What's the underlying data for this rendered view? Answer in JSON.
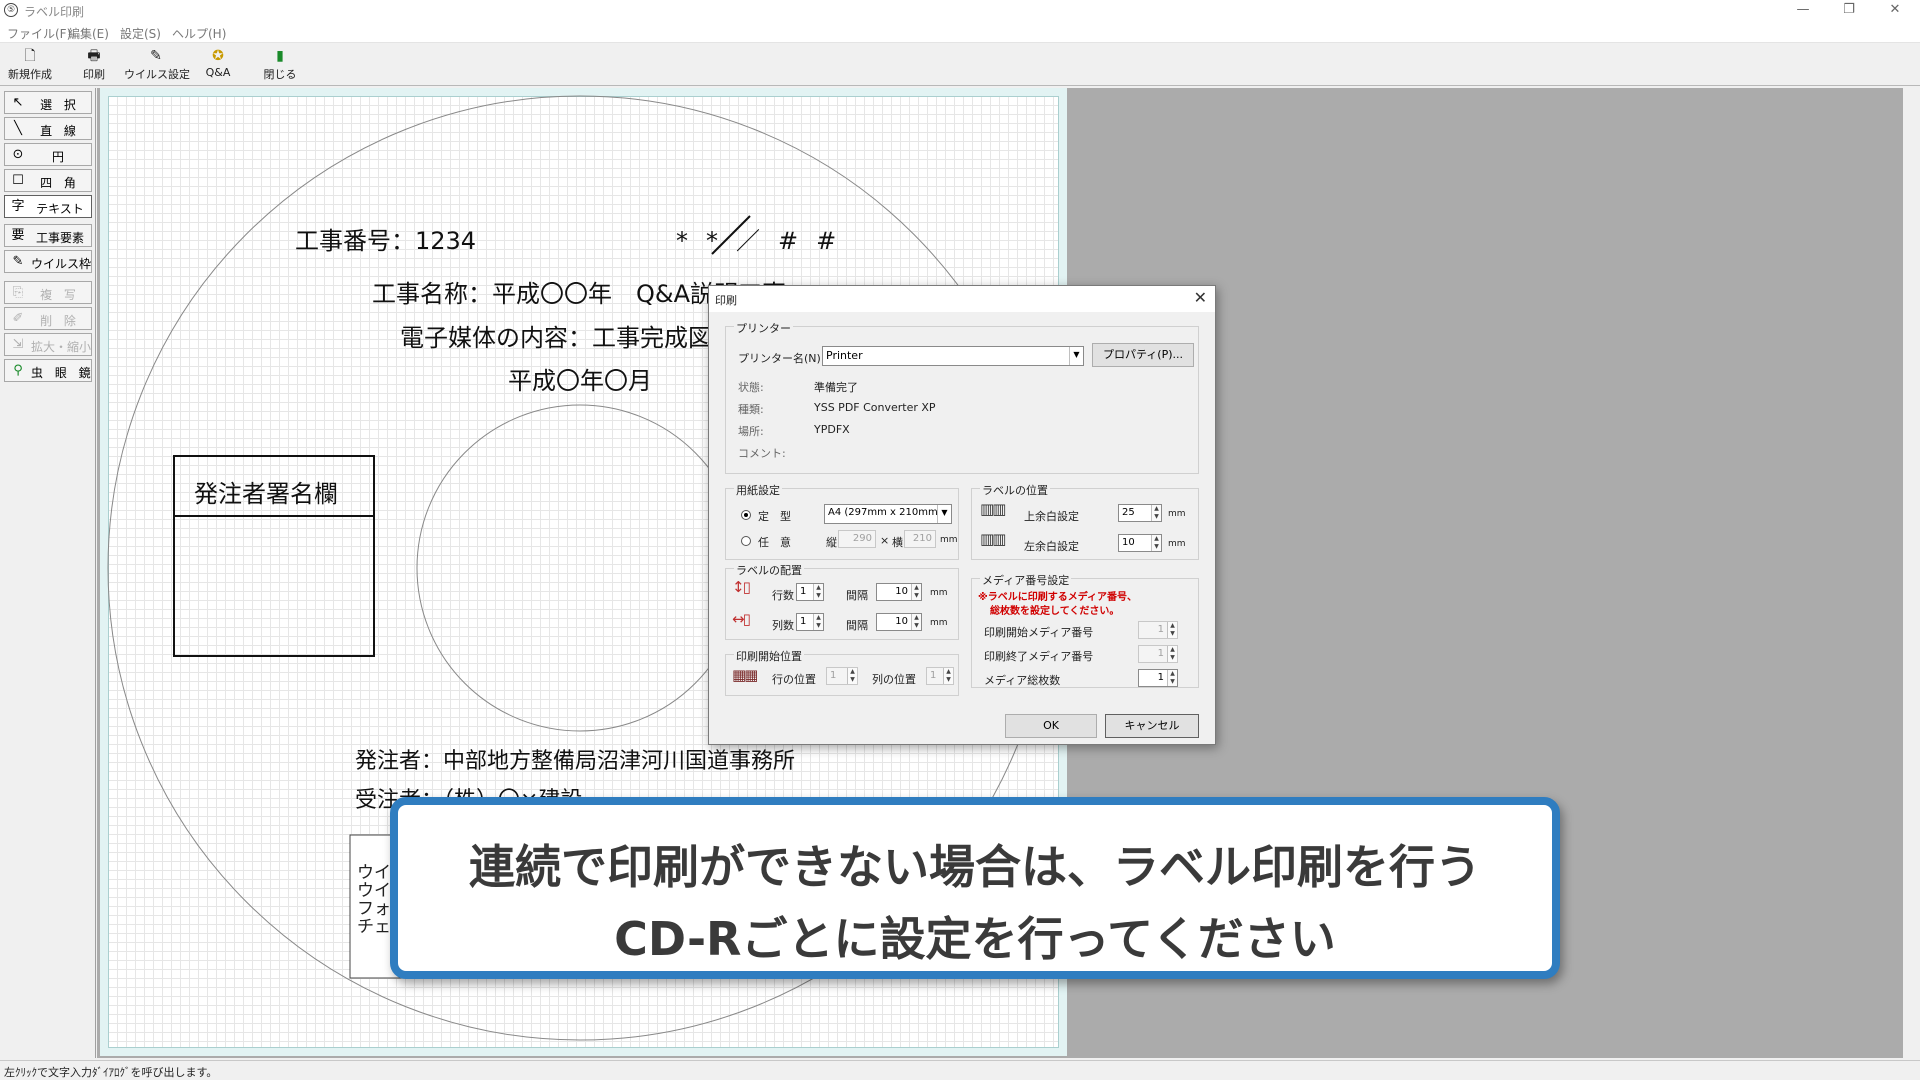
{
  "window": {
    "title": "ラベル印刷",
    "app_icon": "⑤",
    "minimize_icon": "—",
    "restore_icon": "❐",
    "close_icon": "✕"
  },
  "menu": [
    "ファイル(F)",
    "編集(E)",
    "設定(S)",
    "ヘルプ(H)"
  ],
  "toolbar": [
    {
      "label": "新規作成",
      "icon": "new-file-icon",
      "glyph": "🗋"
    },
    {
      "label": "印刷",
      "icon": "printer-icon",
      "glyph": "🖶"
    },
    {
      "label": "ウイルス設定",
      "icon": "virus-settings-icon",
      "glyph": "✎"
    },
    {
      "label": "Q&A",
      "icon": "qa-icon",
      "glyph": "✪"
    },
    {
      "label": "閉じる",
      "icon": "exit-door-icon",
      "glyph": "▮"
    }
  ],
  "tools": [
    {
      "label": "選 択",
      "glyph": "↖",
      "icon": "cursor-icon"
    },
    {
      "label": "直 線",
      "glyph": "╲",
      "icon": "line-icon"
    },
    {
      "label": "円",
      "glyph": "⊙",
      "icon": "circle-icon"
    },
    {
      "label": "四 角",
      "glyph": "☐",
      "icon": "rectangle-icon"
    },
    {
      "label": "テキスト",
      "glyph": "字",
      "icon": "text-icon"
    },
    {
      "label": "工事要素",
      "glyph": "要",
      "icon": "construction-element-icon"
    },
    {
      "label": "ウイルス枠",
      "glyph": "✎",
      "icon": "virus-frame-icon"
    },
    {
      "label": "複 写",
      "glyph": "⎘",
      "icon": "copy-icon"
    },
    {
      "label": "削 除",
      "glyph": "✐",
      "icon": "delete-icon"
    },
    {
      "label": "拡大・縮小",
      "glyph": "⇲",
      "icon": "resize-icon"
    },
    {
      "label": "虫 眼 鏡",
      "glyph": "⚲",
      "icon": "magnifier-icon"
    }
  ],
  "label": {
    "line1": "工事番号：1234",
    "date_mark": "**／##",
    "line2": "工事名称：平成〇〇年　Q&A説明工事",
    "line3": "電子媒体の内容：工事完成図",
    "line4": "平成〇年〇月",
    "signature_box": "発注者署名欄",
    "client": "発注者：中部地方整備局沼津河川国道事務所",
    "contractor": "受注者：（株）〇×建設",
    "virus_box_lines": [
      "ウイ",
      "ウイ",
      "フォ",
      "チェ"
    ]
  },
  "status_bar": "左ｸﾘｯｸで文字入力ﾀﾞｲｱﾛｸﾞを呼び出します。",
  "dialog": {
    "title": "印刷",
    "close": "✕",
    "printer_group": "プリンター",
    "printer_name_label": "プリンター名(N):",
    "printer_name_value": "Printer",
    "properties_button": "プロパティ(P)...",
    "status_label": "状態:",
    "status_value": "準備完了",
    "type_label": "種類:",
    "type_value": "YSS PDF Converter XP",
    "location_label": "場所:",
    "location_value": "YPDFX",
    "comment_label": "コメント:",
    "paper_group": "用紙設定",
    "fixed_label": "定　型",
    "fixed_value": "A4 (297mm x 210mm)",
    "custom_label": "任　意",
    "height_label": "縦",
    "height_value": "290",
    "times": "×",
    "width_label": "横",
    "width_value": "210",
    "mm": "mm",
    "label_pos_group": "ラベルの位置",
    "top_margin_label": "上余白設定",
    "top_margin_value": "25",
    "left_margin_label": "左余白設定",
    "left_margin_value": "10",
    "layout_group": "ラベルの配置",
    "rows_label": "行数",
    "rows_value": "1",
    "cols_label": "列数",
    "cols_value": "1",
    "gap_label": "間隔",
    "row_gap_value": "10",
    "col_gap_value": "10",
    "media_group": "メディア番号設定",
    "media_note_1": "※ラベルに印刷するメディア番号、",
    "media_note_2": "総枚数を設定してください。",
    "media_start_label": "印刷開始メディア番号",
    "media_start_value": "1",
    "media_end_label": "印刷終了メディア番号",
    "media_end_value": "1",
    "media_total_label": "メディア総枚数",
    "media_total_value": "1",
    "start_pos_group": "印刷開始位置",
    "row_pos_label": "行の位置",
    "row_pos_value": "1",
    "col_pos_label": "列の位置",
    "col_pos_value": "1",
    "ok_button": "OK",
    "cancel_button": "キャンセル"
  },
  "caption": {
    "line1": "連続で印刷ができない場合は、ラベル印刷を行う",
    "line2": "CD-Rごとに設定を行ってください"
  },
  "colors": {
    "caption_border": "#2f7dc0",
    "workspace": "#ababab",
    "media_note": "#d00000"
  }
}
